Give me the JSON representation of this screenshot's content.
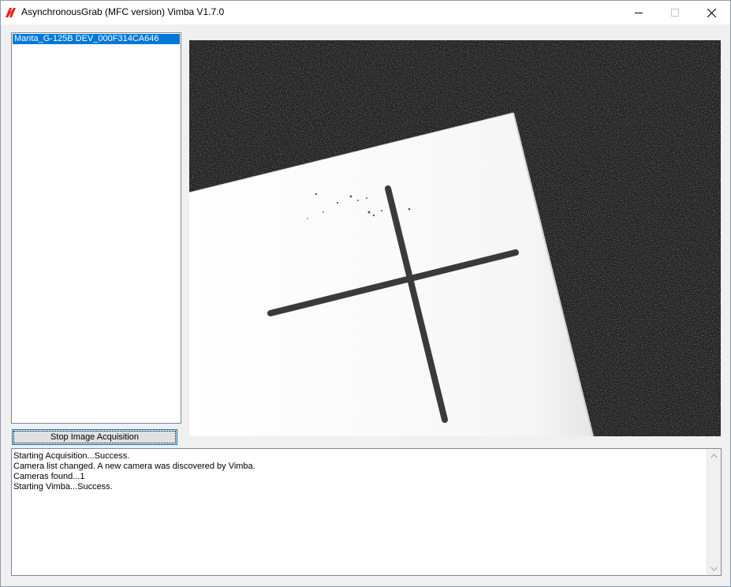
{
  "window": {
    "title": "AsynchronousGrab (MFC version) Vimba V1.7.0",
    "icon": "vimba-logo-icon",
    "accent_color": "#e8261b"
  },
  "camera_list": {
    "items": [
      {
        "label": "Manta_G-125B DEV_000F314CA646",
        "selected": true
      }
    ]
  },
  "acquisition_button": {
    "label": "Stop Image Acquisition"
  },
  "log": {
    "lines": [
      "Starting Acquisition...Success.",
      "Camera list changed. A new camera was discovered by Vimba.",
      "Cameras found...1",
      "Starting Vimba...Success."
    ]
  },
  "colors": {
    "selection": "#0078d7",
    "button_border": "#0078d7"
  }
}
